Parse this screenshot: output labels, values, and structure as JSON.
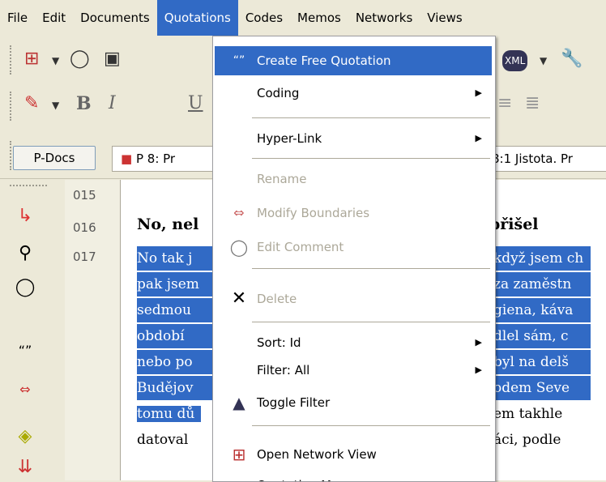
{
  "menubar": {
    "items": [
      "File",
      "Edit",
      "Documents",
      "Quotations",
      "Codes",
      "Memos",
      "Networks",
      "Views"
    ]
  },
  "tabs": {
    "pdocs": "P-Docs",
    "doc_tab": "P 8: Pr",
    "quote_tab": "8:1 Jistota. Pr"
  },
  "line_numbers": [
    "015",
    "016",
    "017"
  ],
  "document": {
    "heading_left": "No, nel",
    "heading_right": "přišel",
    "lines": [
      {
        "left": "No tak j",
        "right": "když jsem ch"
      },
      {
        "left": "pak jsem",
        "right": "za zaměstn"
      },
      {
        "left": "sedmou",
        "right": "giena, káva"
      },
      {
        "left": "období",
        "right": "dlel sám, c"
      },
      {
        "left": "nebo po",
        "right": "byl na delš"
      },
      {
        "left": "Budějov",
        "right": "odem Seve"
      },
      {
        "left": "tomu dů",
        "right": "em takhle"
      },
      {
        "left": "datoval",
        "right": "áci, podle"
      }
    ]
  },
  "quotations_menu": {
    "create_free_quotation": "Create Free Quotation",
    "coding": "Coding",
    "hyper_link": "Hyper-Link",
    "rename": "Rename",
    "modify_boundaries": "Modify Boundaries",
    "edit_comment": "Edit Comment",
    "delete": "Delete",
    "sort": "Sort: Id",
    "filter": "Filter: All",
    "toggle_filter": "Toggle Filter",
    "open_network_view": "Open Network View",
    "last_item": "Quotation Ma"
  },
  "colors": {
    "highlight": "#316ac5",
    "disabled": "#aca899",
    "chrome": "#ece9d8"
  }
}
